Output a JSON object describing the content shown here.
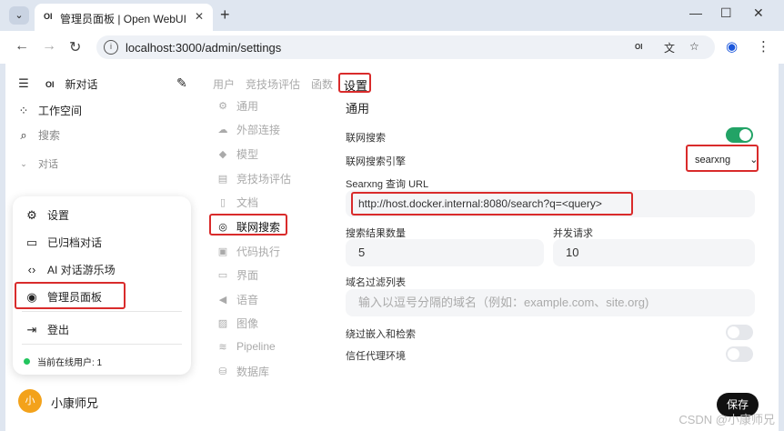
{
  "browser": {
    "tab_menu": "⌄",
    "tab_favicon": "OI",
    "tab_title": "管理员面板 | Open WebUI",
    "tab_close": "✕",
    "new_tab": "+",
    "url": "localhost:3000/admin/settings",
    "omni_ext": "OI"
  },
  "sidebar": {
    "new_chat": "新对话",
    "logo": "OI",
    "workspace": "工作空间",
    "search": "搜索",
    "chats_section": "对话",
    "user_name": "小康师兄",
    "avatar_text": "小"
  },
  "user_menu": {
    "settings": "设置",
    "archived": "已归档对话",
    "playground": "AI 对话游乐场",
    "admin_panel": "管理员面板",
    "logout": "登出",
    "online_users": "当前在线用户: 1"
  },
  "admin_tabs": [
    "用户",
    "竞技场评估",
    "函数",
    "设置"
  ],
  "settings_nav": [
    {
      "icon": "gear-icon",
      "glyph": "⚙",
      "label": "通用"
    },
    {
      "icon": "cloud-icon",
      "glyph": "☁",
      "label": "外部连接"
    },
    {
      "icon": "cube-icon",
      "glyph": "◆",
      "label": "模型"
    },
    {
      "icon": "document-icon",
      "glyph": "▤",
      "label": "竞技场评估"
    },
    {
      "icon": "file-icon",
      "glyph": "▯",
      "label": "文档"
    },
    {
      "icon": "globe-icon",
      "glyph": "◎",
      "label": "联网搜索"
    },
    {
      "icon": "terminal-icon",
      "glyph": "▣",
      "label": "代码执行"
    },
    {
      "icon": "monitor-icon",
      "glyph": "▭",
      "label": "界面"
    },
    {
      "icon": "speaker-icon",
      "glyph": "◀",
      "label": "语音"
    },
    {
      "icon": "image-icon",
      "glyph": "▨",
      "label": "图像"
    },
    {
      "icon": "stack-icon",
      "glyph": "≋",
      "label": "Pipeline"
    },
    {
      "icon": "database-icon",
      "glyph": "⛁",
      "label": "数据库"
    }
  ],
  "web_search": {
    "section_title": "通用",
    "enable_label": "联网搜索",
    "enable_on": true,
    "engine_label": "联网搜索引擎",
    "engine_value": "searxng",
    "searxng_url_label": "Searxng 查询 URL",
    "searxng_url_value": "http://host.docker.internal:8080/search?q=<query>",
    "result_count_label": "搜索结果数量",
    "result_count_value": "5",
    "concurrent_label": "并发请求",
    "concurrent_value": "10",
    "domain_filter_label": "域名过滤列表",
    "domain_filter_placeholder": "输入以逗号分隔的域名（例如：example.com、site.org)",
    "bypass_label": "绕过嵌入和检索",
    "bypass_on": false,
    "trust_proxy_label": "信任代理环境",
    "trust_proxy_on": false,
    "save_label": "保存"
  },
  "watermark": "CSDN @小康师兄",
  "colors": {
    "accent_toggle": "#22a366",
    "highlight_box": "#d92b2b",
    "online": "#22c55e",
    "avatar": "#f3a21b"
  }
}
